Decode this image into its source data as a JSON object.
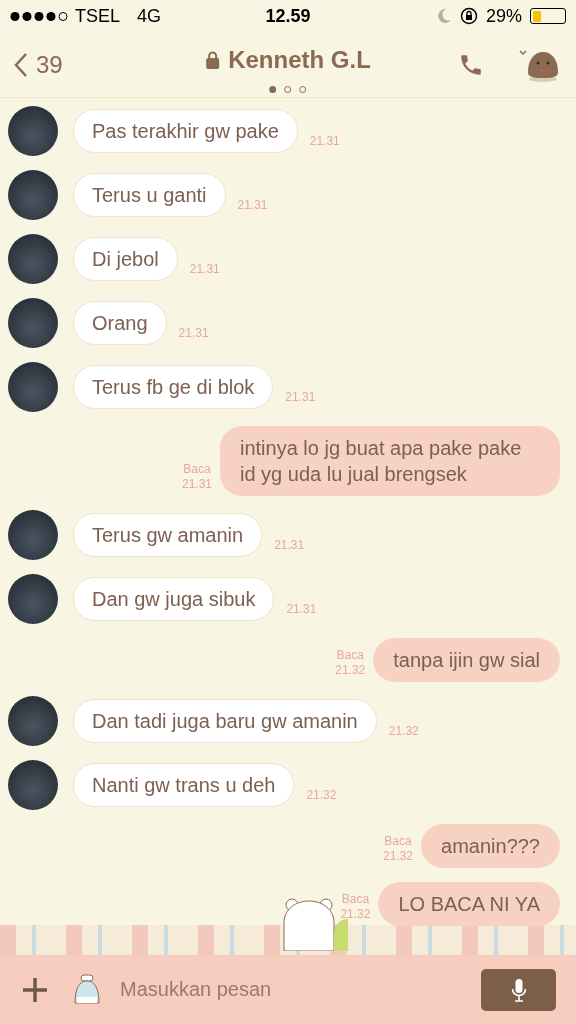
{
  "status_bar": {
    "carrier": "TSEL",
    "network": "4G",
    "time": "12.59",
    "battery": "29%"
  },
  "header": {
    "back_count": "39",
    "title": "Kenneth G.L",
    "pages": [
      {
        "selected": true
      },
      {
        "selected": false
      },
      {
        "selected": false
      }
    ]
  },
  "messages": [
    {
      "kind": "received",
      "text": "Pas terakhir gw pake",
      "time": "21.31"
    },
    {
      "kind": "received",
      "text": "Terus u ganti",
      "time": "21.31"
    },
    {
      "kind": "received",
      "text": "Di jebol",
      "time": "21.31"
    },
    {
      "kind": "received",
      "text": "Orang",
      "time": "21.31"
    },
    {
      "kind": "received",
      "text": "Terus fb ge di blok",
      "time": "21.31"
    },
    {
      "kind": "sent",
      "text": "intinya lo jg buat apa pake pake id yg uda lu jual brengsek",
      "read": "Baca",
      "time": "21.31"
    },
    {
      "kind": "received",
      "text": "Terus gw amanin",
      "time": "21.31"
    },
    {
      "kind": "received",
      "text": "Dan gw juga sibuk",
      "time": "21.31"
    },
    {
      "kind": "sent",
      "text": "tanpa ijin gw sial",
      "read": "Baca",
      "time": "21.32"
    },
    {
      "kind": "received",
      "text": "Dan tadi juga baru gw amanin",
      "time": "21.32"
    },
    {
      "kind": "received",
      "text": "Nanti gw trans u deh",
      "time": "21.32"
    },
    {
      "kind": "sent",
      "text": "amanin???",
      "read": "Baca",
      "time": "21.32"
    },
    {
      "kind": "sent",
      "text": "LO BACA NI YA",
      "read": "Baca",
      "time": "21.32"
    }
  ],
  "composer": {
    "placeholder": "Masukkan pesan"
  }
}
